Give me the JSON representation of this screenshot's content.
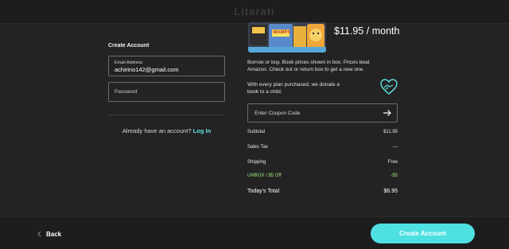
{
  "header": {
    "brand": "Literati"
  },
  "account": {
    "title": "Create Account",
    "email_label": "Email Address",
    "email_value": "achirino142@gmail.com",
    "password_placeholder": "Password",
    "login_prompt": "Already have an account?",
    "login_link": "Log In"
  },
  "plan": {
    "price": "$11.95 / month",
    "description": "Borrow or buy. Book prices shown in box. Prices beat Amazon. Check out or return box to get a new one.",
    "donation": "With every plan purchased, we donate a book to a child.",
    "boxart_text": "WAMPS"
  },
  "coupon": {
    "placeholder": "Enter Coupon Code"
  },
  "summary": {
    "subtotal_label": "Subtotal",
    "subtotal_value": "$11.95",
    "tax_label": "Sales Tax",
    "tax_value": "—",
    "shipping_label": "Shipping",
    "shipping_value": "Free",
    "discount_label": "UNBOX / $5 Off",
    "discount_value": "-$5",
    "total_label": "Today's Total",
    "total_value": "$6.95"
  },
  "footer": {
    "back_label": "Back",
    "create_label": "Create Account"
  },
  "colors": {
    "accent": "#4fe0e2",
    "link": "#5fe3e3",
    "discount": "#9be87a",
    "background": "#232323"
  }
}
